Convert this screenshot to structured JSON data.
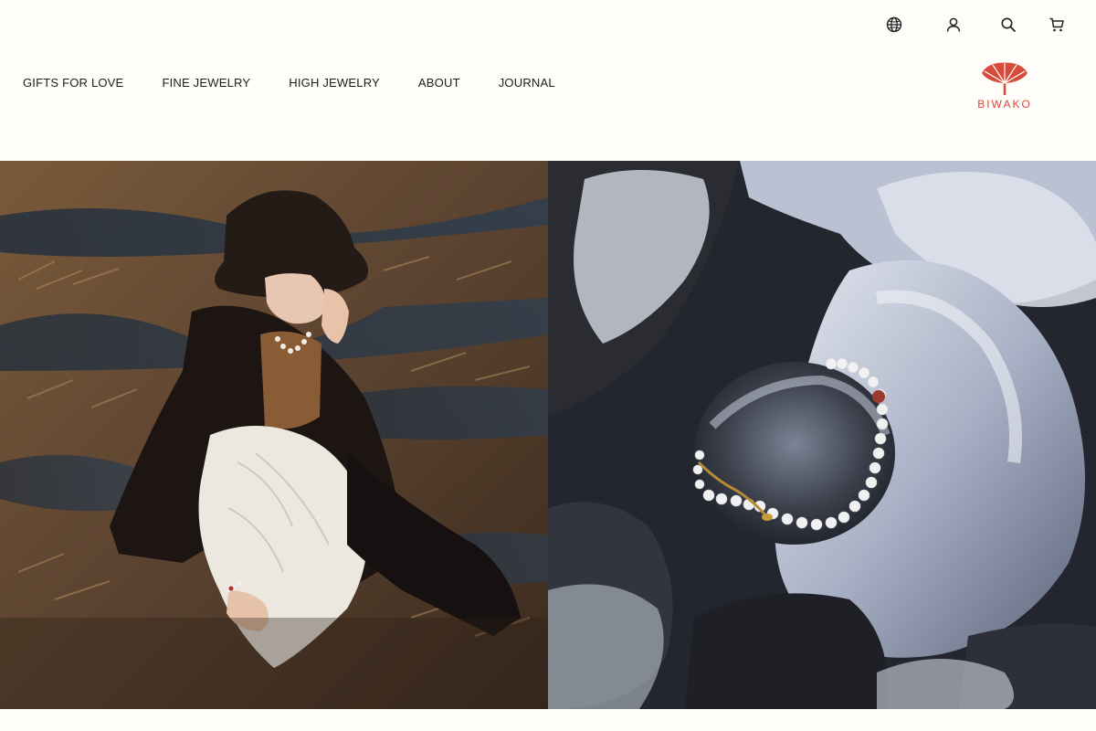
{
  "brand": {
    "name": "BIWAKO",
    "color": "#d84a3a"
  },
  "utility": {
    "icons": [
      "globe-icon",
      "account-icon",
      "search-icon",
      "cart-icon"
    ]
  },
  "nav": {
    "items": [
      {
        "label": "GIFTS FOR LOVE"
      },
      {
        "label": "FINE JEWELRY"
      },
      {
        "label": "HIGH JEWELRY"
      },
      {
        "label": "ABOUT"
      },
      {
        "label": "JOURNAL"
      }
    ]
  },
  "hero": {
    "left_image": "model-in-black-hat-on-marsh-photo",
    "right_image": "pearl-bracelet-on-icy-rock-photo"
  }
}
